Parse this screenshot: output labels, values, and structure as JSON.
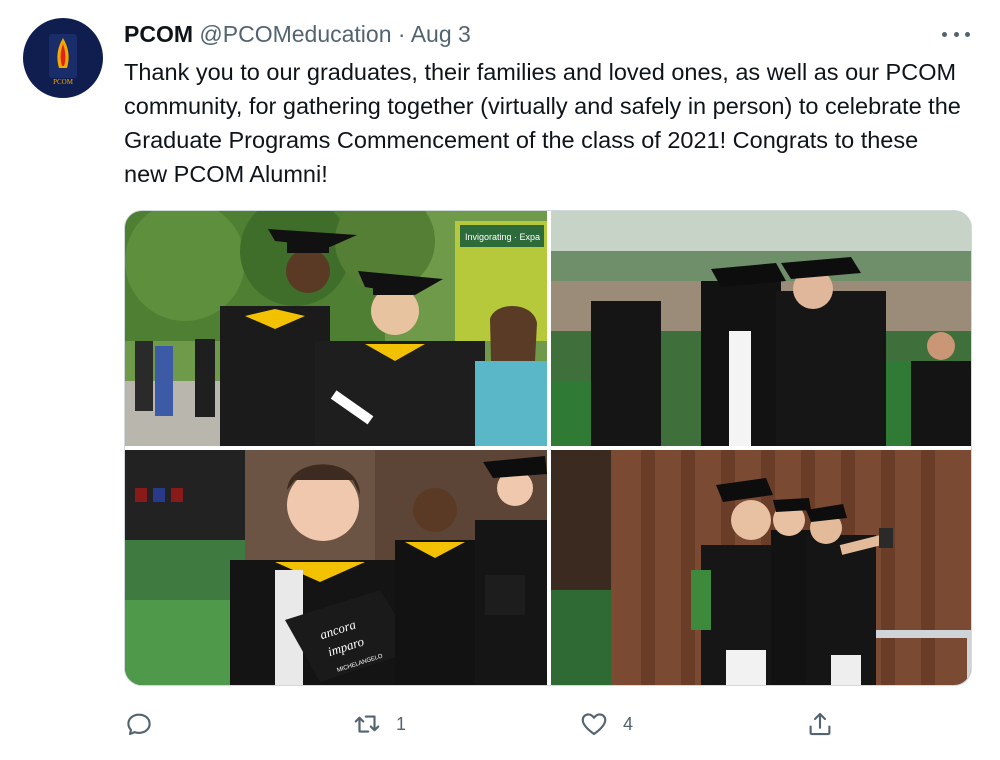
{
  "tweet": {
    "author_name": "PCOM",
    "author_handle": "@PCOMeducation",
    "separator": "·",
    "date": "Aug 3",
    "avatar_text": "PCOM",
    "text": "Thank you to our graduates, their families and loved ones, as well as our PCOM community, for gathering together (virtually and safely in person) to celebrate the Graduate Programs Commencement of the class of 2021! Congrats to these new PCOM Alumni!"
  },
  "media": {
    "photo1": {
      "sign_text_1": "Invigorating · Expa"
    },
    "photo3": {
      "cap_line_1": "ancora",
      "cap_line_2": "imparo",
      "cap_line_3": "MICHELANGELO"
    }
  },
  "actions": {
    "reply_icon": "reply-icon",
    "retweet_icon": "retweet-icon",
    "retweet_count": "1",
    "like_icon": "heart-icon",
    "like_count": "4",
    "share_icon": "share-icon"
  },
  "colors": {
    "text": "#0f1419",
    "secondary": "#536471",
    "avatar_bg": "#0f1e4f",
    "border": "#cfd9de"
  }
}
